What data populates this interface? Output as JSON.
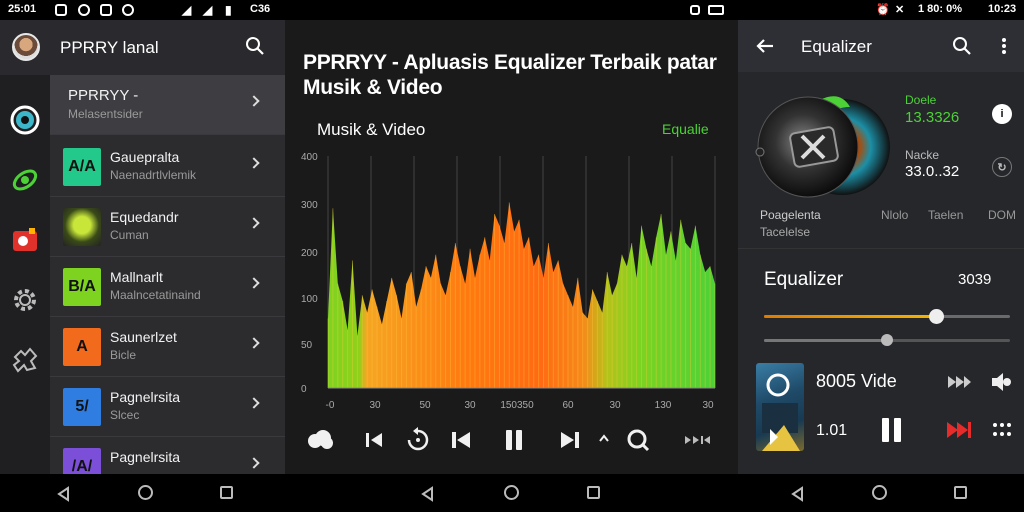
{
  "status_bar": {
    "time_left": "25:01",
    "center_text": "C36",
    "right_text": "1 80: 0%",
    "time_right": "10:23"
  },
  "left_panel": {
    "header_title": "PPRRY lanal",
    "active_item": {
      "title": "PPRRYY -",
      "subtitle": "Melasentsider"
    },
    "items": [
      {
        "title": "Gauepralta",
        "subtitle": "Naenadrtlvlemik",
        "thumb": "A/A",
        "thumb_color": "#22c98a"
      },
      {
        "title": "Equedandr",
        "subtitle": "Cuman",
        "thumb": "",
        "thumb_color": "#8fc31f"
      },
      {
        "title": "Mallnarlt",
        "subtitle": "Maalncetatinaind",
        "thumb": "B/A",
        "thumb_color": "#7ed321"
      },
      {
        "title": "Saunerlzet",
        "subtitle": "Bicle",
        "thumb": "A",
        "thumb_color": "#f26b1d"
      },
      {
        "title": "Pagnelrsita",
        "subtitle": "Slcec",
        "thumb": "5/",
        "thumb_color": "#2f7de1"
      },
      {
        "title": "Pagnelrsita",
        "subtitle": "",
        "thumb": "/A/",
        "thumb_color": "#7b4fd8"
      }
    ],
    "rail_icons": [
      "eye-ring-icon",
      "satellite-icon",
      "apple-icon",
      "gear-icon",
      "puzzle-icon"
    ]
  },
  "middle_panel": {
    "title": "PPRRYY - Apluasis Equalizer Terbaik patar Musik & Video",
    "chart_label": "Musik & Video",
    "chart_tag": "Equalie",
    "controls": [
      "cloud-icon",
      "skip-back-icon",
      "replay-icon",
      "prev-icon",
      "pause-icon",
      "next-icon",
      "caret-up-icon",
      "search-icon",
      "fast-forward-icon"
    ]
  },
  "chart_data": {
    "type": "area",
    "y_ticks": [
      "400",
      "300",
      "200",
      "100",
      "50",
      "0"
    ],
    "x_ticks": [
      "-0",
      "30",
      "50",
      "30",
      "100",
      "150350",
      "60",
      "30",
      "130",
      "30"
    ],
    "x": [
      0,
      1,
      2,
      3,
      4,
      5,
      6,
      7,
      8,
      9,
      10,
      11,
      12,
      13,
      14,
      15,
      16,
      17,
      18,
      19,
      20,
      21,
      22,
      23,
      24,
      25,
      26,
      27,
      28,
      29,
      30,
      31,
      32,
      33,
      34,
      35,
      36,
      37,
      38,
      39,
      40,
      41,
      42,
      43,
      44,
      45,
      46,
      47,
      48,
      49,
      50,
      51,
      52,
      53,
      54,
      55,
      56,
      57,
      58,
      59,
      60,
      61,
      62,
      63,
      64,
      65,
      66,
      67,
      68,
      69,
      70,
      71,
      72,
      73,
      74,
      75,
      76,
      77,
      78,
      79
    ],
    "values": [
      120,
      310,
      180,
      150,
      100,
      220,
      90,
      160,
      130,
      170,
      140,
      110,
      150,
      190,
      160,
      120,
      180,
      200,
      140,
      170,
      210,
      190,
      230,
      180,
      160,
      200,
      250,
      210,
      180,
      240,
      190,
      230,
      260,
      220,
      300,
      280,
      250,
      320,
      270,
      290,
      240,
      260,
      210,
      230,
      190,
      250,
      200,
      220,
      180,
      160,
      140,
      190,
      130,
      120,
      170,
      150,
      130,
      200,
      160,
      180,
      230,
      210,
      250,
      190,
      280,
      240,
      210,
      260,
      300,
      230,
      270,
      220,
      290,
      250,
      240,
      280,
      230,
      200,
      210,
      180
    ],
    "colors": [
      "#7ed321",
      "#f5a623",
      "#ff6a13",
      "#4cd137"
    ],
    "ylim": [
      0,
      400
    ]
  },
  "right_panel": {
    "header_title": "Equalizer",
    "stat1_label": "Doele",
    "stat1_value": "13.3326",
    "stat2_label": "Nacke",
    "stat2_value": "33.0..32",
    "info_left1": "Poagelenta",
    "info_left2": "Tacelelse",
    "info_mid": "Nlolo",
    "info_mid2": "Taelen",
    "info_right": "DOM",
    "eq_title": "Equalizer",
    "eq_value": "3039",
    "slider1_level": 0.7,
    "slider2_level": 0.5,
    "player_title": "8005 Vide",
    "player_time": "1.01"
  }
}
